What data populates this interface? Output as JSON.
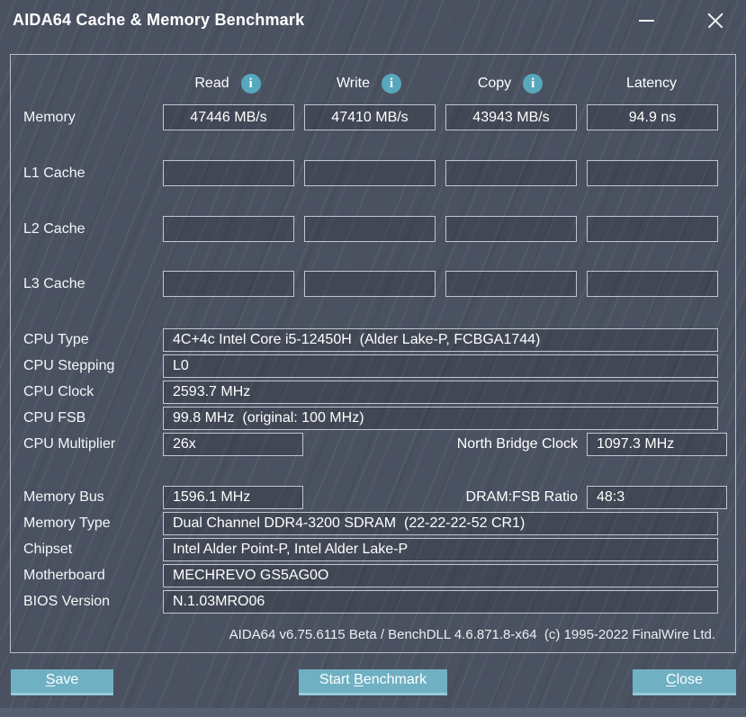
{
  "colors": {
    "accent": "#58a8bd",
    "button": "#6fb0c2",
    "button_highlight": "#93cbd8",
    "window_bg": "#4a5160",
    "box_border": "#c2c6ce",
    "panel_border": "#b9bec7",
    "bottom_strip": "#556173"
  },
  "titlebar": {
    "title": "AIDA64 Cache & Memory Benchmark"
  },
  "header": {
    "info_glyph": "i",
    "columns": [
      {
        "label": "Read"
      },
      {
        "label": "Write"
      },
      {
        "label": "Copy"
      },
      {
        "label": "Latency"
      }
    ]
  },
  "benchmark": {
    "rows": [
      {
        "label": "Memory",
        "read": "47446 MB/s",
        "write": "47410 MB/s",
        "copy": "43943 MB/s",
        "latency": "94.9 ns"
      },
      {
        "label": "L1 Cache",
        "read": "",
        "write": "",
        "copy": "",
        "latency": ""
      },
      {
        "label": "L2 Cache",
        "read": "",
        "write": "",
        "copy": "",
        "latency": ""
      },
      {
        "label": "L3 Cache",
        "read": "",
        "write": "",
        "copy": "",
        "latency": ""
      }
    ]
  },
  "system": {
    "cpu_type": {
      "label": "CPU Type",
      "value": "4C+4c Intel Core i5-12450H  (Alder Lake-P, FCBGA1744)"
    },
    "cpu_stepping": {
      "label": "CPU Stepping",
      "value": "L0"
    },
    "cpu_clock": {
      "label": "CPU Clock",
      "value": "2593.7 MHz"
    },
    "cpu_fsb": {
      "label": "CPU FSB",
      "value": "99.8 MHz  (original: 100 MHz)"
    },
    "cpu_multiplier": {
      "label": "CPU Multiplier",
      "value": "26x"
    },
    "north_bridge_clock": {
      "label": "North Bridge Clock",
      "value": "1097.3 MHz"
    },
    "memory_bus": {
      "label": "Memory Bus",
      "value": "1596.1 MHz"
    },
    "dram_fsb_ratio": {
      "label": "DRAM:FSB Ratio",
      "value": "48:3"
    },
    "memory_type": {
      "label": "Memory Type",
      "value": "Dual Channel DDR4-3200 SDRAM  (22-22-22-52 CR1)"
    },
    "chipset": {
      "label": "Chipset",
      "value": "Intel Alder Point-P, Intel Alder Lake-P"
    },
    "motherboard": {
      "label": "Motherboard",
      "value": "MECHREVO GS5AG0O"
    },
    "bios_version": {
      "label": "BIOS Version",
      "value": "N.1.03MRO06"
    }
  },
  "footer": {
    "text": "AIDA64 v6.75.6115 Beta / BenchDLL 4.6.871.8-x64  (c) 1995-2022 FinalWire Ltd."
  },
  "buttons": {
    "save": {
      "pre": "",
      "key": "S",
      "post": "ave"
    },
    "start_benchmark": {
      "pre": "Start ",
      "key": "B",
      "post": "enchmark"
    },
    "close": {
      "pre": "",
      "key": "C",
      "post": "lose"
    }
  }
}
